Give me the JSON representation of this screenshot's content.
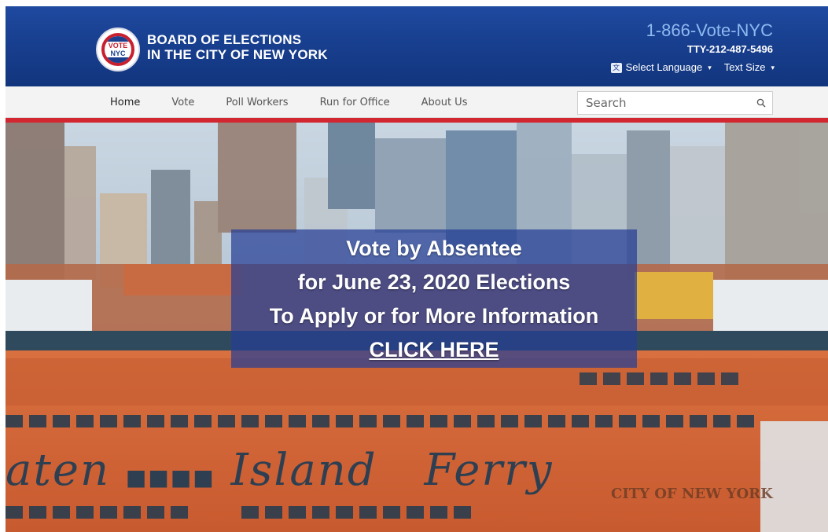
{
  "header": {
    "org_line1": "BOARD OF ELECTIONS",
    "org_line2": "IN THE CITY OF NEW YORK",
    "logo_text_line1": "VOTE",
    "logo_text_line2": "NYC",
    "phone": "1-866-Vote-NYC",
    "tty": "TTY-212-487-5496",
    "select_language": "Select Language",
    "text_size": "Text Size"
  },
  "nav": {
    "items": [
      {
        "label": "Home",
        "active": true
      },
      {
        "label": "Vote",
        "active": false
      },
      {
        "label": "Poll Workers",
        "active": false
      },
      {
        "label": "Run for Office",
        "active": false
      },
      {
        "label": "About Us",
        "active": false
      }
    ],
    "search_placeholder": "Search"
  },
  "hero": {
    "line1": "Vote by Absentee",
    "line2": "for June 23, 2020 Elections",
    "line3": "To Apply or for More Information",
    "link": "CLICK HERE",
    "ferry_text": "aten",
    "ferry_text2": "Island",
    "ferry_text3": "Ferry",
    "ferry_city": "CITY OF NEW YORK"
  },
  "colors": {
    "header_blue": "#183f8f",
    "phone_blue": "#8fb9f0",
    "accent_red": "#d22630",
    "ferry_orange": "#d9663a",
    "banner_blue": "#263e96"
  }
}
